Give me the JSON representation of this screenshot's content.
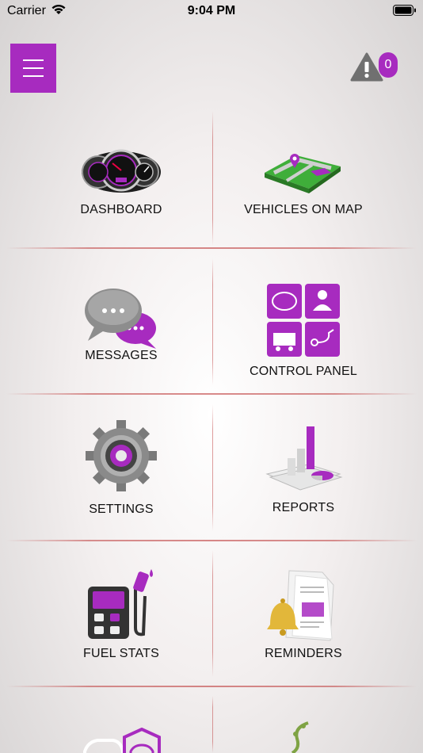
{
  "status_bar": {
    "carrier": "Carrier",
    "time": "9:04 PM"
  },
  "header": {
    "alert_count": "0"
  },
  "tiles": [
    {
      "label": "DASHBOARD",
      "icon": "speedometer-icon"
    },
    {
      "label": "VEHICLES ON MAP",
      "icon": "map-icon"
    },
    {
      "label": "MESSAGES",
      "icon": "chat-bubbles-icon"
    },
    {
      "label": "CONTROL PANEL",
      "icon": "control-panel-icon"
    },
    {
      "label": "SETTINGS",
      "icon": "gear-icon"
    },
    {
      "label": "REPORTS",
      "icon": "report-chart-icon"
    },
    {
      "label": "FUEL STATS",
      "icon": "fuel-pump-icon"
    },
    {
      "label": "REMINDERS",
      "icon": "bell-document-icon"
    }
  ],
  "colors": {
    "accent": "#a72bbf",
    "divider": "#be3c3c"
  }
}
